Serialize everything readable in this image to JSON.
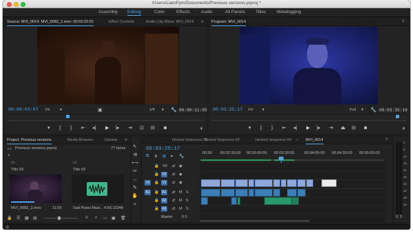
{
  "window": {
    "title": "/Users/LiamPym/Documents/Previous versions.prproj *"
  },
  "workspaces": [
    "Assembly",
    "Editing",
    "Color",
    "Effects",
    "Audio",
    "All Panels",
    "Titles",
    "Metalogging"
  ],
  "workspace_active": "Editing",
  "source_panel": {
    "tabs": [
      "Source: MVI_0014: MVI_0082_2.mov: 00:03:22:01",
      "Effect Controls",
      "Audio Clip Mixer: MVI_0014"
    ],
    "more": "»",
    "timecode": "00:00:03:07",
    "fit": "Fit",
    "fraction": "1/4",
    "duration": "00:00:11:05",
    "add": "+"
  },
  "program_panel": {
    "tabs": [
      "Program: MVI_0014"
    ],
    "menu": "≡",
    "timecode": "00:03:25:17",
    "fit": "Fit",
    "quality": "Full",
    "duration": "00:03:35:19",
    "add": "+"
  },
  "project_panel": {
    "tabs": [
      "Project: Previous versions",
      "Media Browser",
      "Librarie"
    ],
    "more": "»",
    "file": "Previous versions.prproj",
    "items_count": "77 Items",
    "items": [
      {
        "name": "Title 03",
        "kind": "title"
      },
      {
        "name": "Title 03",
        "kind": "title"
      },
      {
        "name": "MVI_0082_2.mov",
        "duration": "11:05",
        "kind": "video"
      },
      {
        "name": "Sad Piano Musi...",
        "duration": "4:56:12348",
        "kind": "audio"
      }
    ]
  },
  "timeline": {
    "tabs": [
      "Nested Sequence 01",
      "Nested Sequence 02",
      "Nested Sequence 04",
      "MVI_0014"
    ],
    "active_tab": "MVI_0014",
    "close": "×",
    "menu": "≡",
    "timecode": "00:03:25:17",
    "ruler": [
      "00:00",
      "00:02:30:00",
      "00:03:00:00",
      "00:03:30:00",
      "00:04:00:00",
      "00:04:30:00",
      "00:05:00:00"
    ],
    "tracks": [
      {
        "name": "V3",
        "type": "video"
      },
      {
        "name": "V2",
        "type": "video"
      },
      {
        "name": "V1",
        "type": "video",
        "source_patch": "V1"
      },
      {
        "name": "A1",
        "type": "audio",
        "source_patch": "A1"
      },
      {
        "name": "A2",
        "type": "audio"
      },
      {
        "name": "A3",
        "type": "audio"
      },
      {
        "name": "Master",
        "type": "master",
        "level": "0.0"
      }
    ],
    "mute": "M",
    "solo": "S",
    "playhead_fraction": 0.52,
    "meter_labels": [
      "0",
      "-6",
      "-12",
      "-18",
      "-24",
      "-30",
      "-36",
      "-42",
      "-48",
      "-54"
    ],
    "meter_solo": [
      "S",
      "S"
    ]
  },
  "colors": {
    "accent_blue": "#4ea6e8",
    "panel_bg": "#232323",
    "app_bg": "#1d1d1d",
    "video_clip": "#8fa8d8",
    "audio_clip": "#3c7fb6",
    "audio_green": "#28996a"
  }
}
